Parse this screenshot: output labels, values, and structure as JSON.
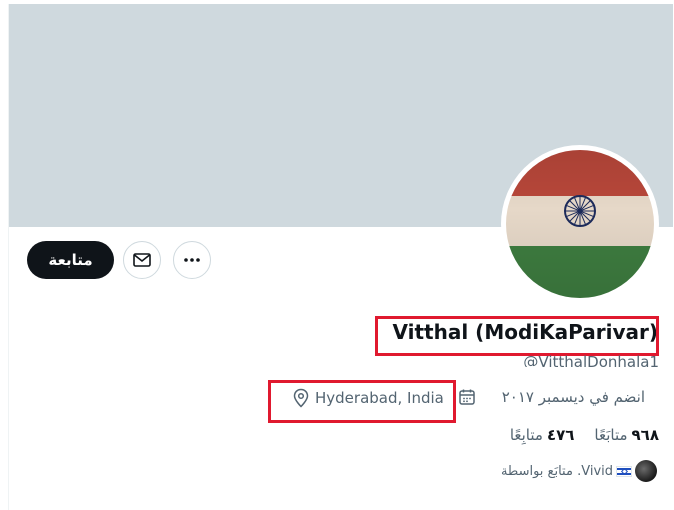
{
  "profile": {
    "display_name": "Vitthal (ModiKaParivar)",
    "handle": "@VitthalDonhala1",
    "location": "Hyderabad, India",
    "joined": "انضم في ديسمبر ٢٠١٧",
    "following_count": "٩٦٨",
    "following_label": "متابَعًا",
    "followers_count": "٤٧٦",
    "followers_label": "متابِعًا",
    "followed_by_text": "Vivid. متابَع بواسطة"
  },
  "actions": {
    "follow_label": "متابعة",
    "more_icon": "more-icon",
    "message_icon": "mail-icon"
  },
  "icons": {
    "calendar": "calendar-icon",
    "location": "location-pin-icon"
  },
  "colors": {
    "banner": "#cfd9de",
    "highlight": "#e0192f",
    "text_primary": "#0f1419",
    "text_secondary": "#536471"
  }
}
